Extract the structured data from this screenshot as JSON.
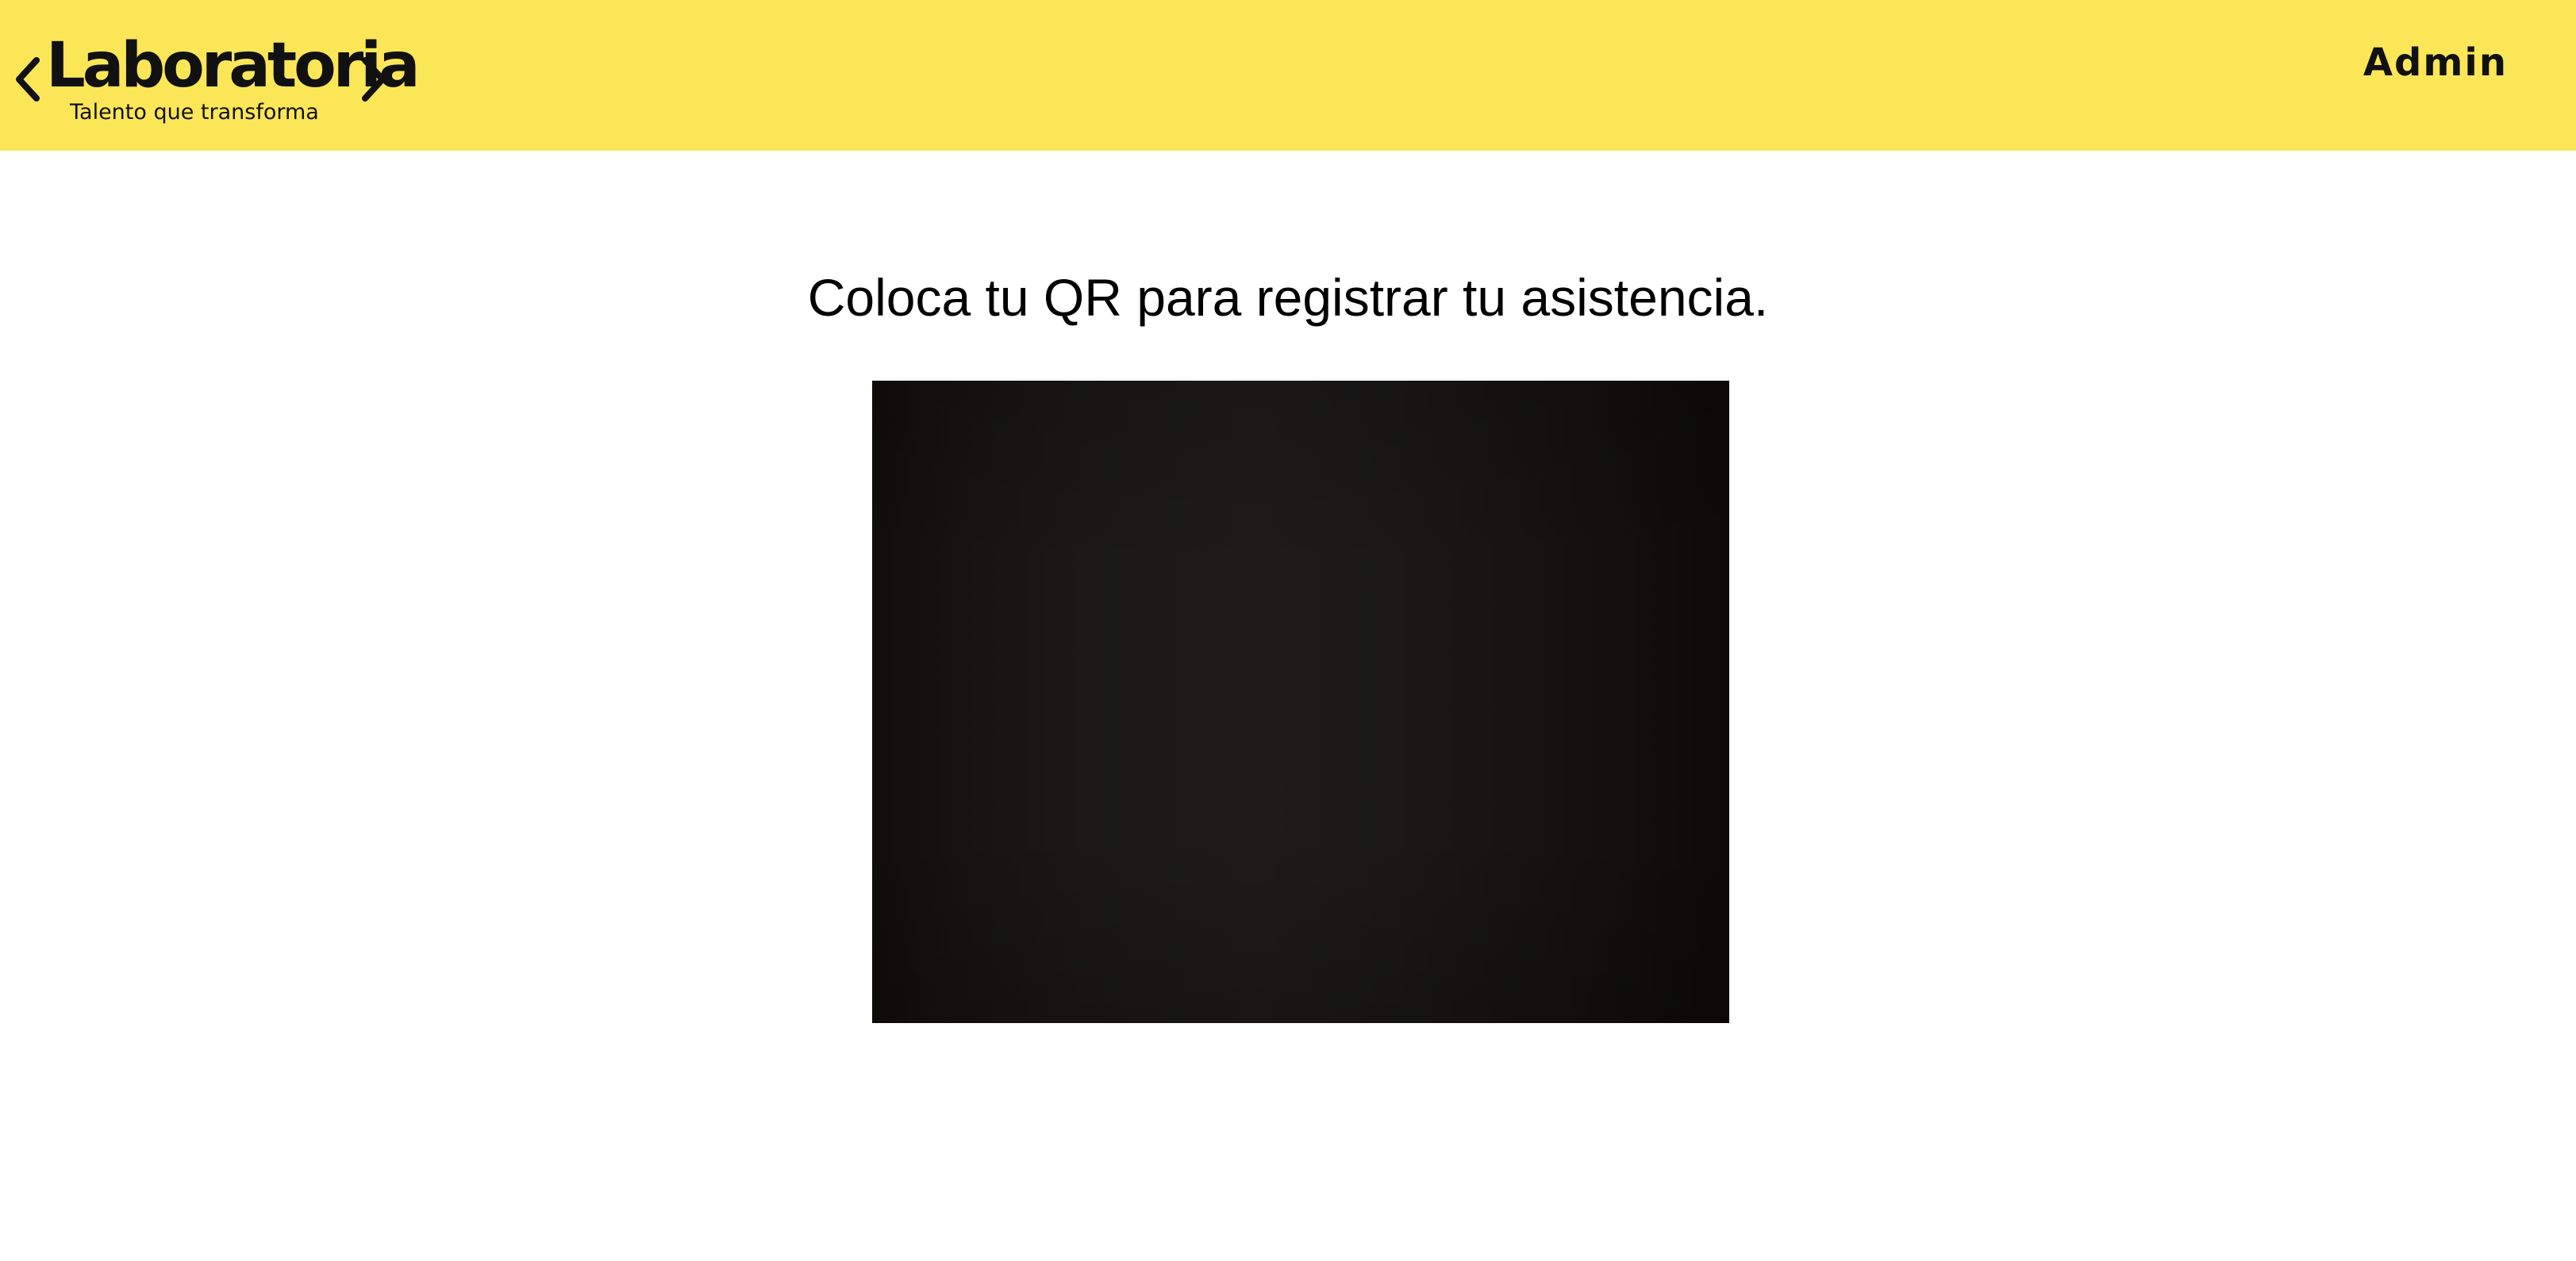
{
  "header": {
    "brand": "Laboratoria",
    "tagline": "Talento que transforma",
    "admin_label": "Admin",
    "background_color": "#fbe658"
  },
  "main": {
    "instruction": "Coloca tu QR para registrar tu asistencia.",
    "camera_icon": "qr-scanner-video"
  }
}
